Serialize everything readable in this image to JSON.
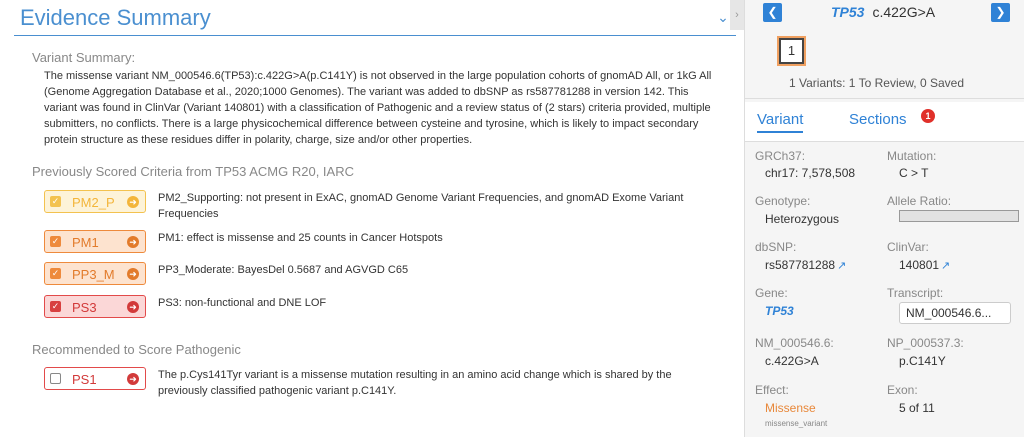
{
  "evidence": {
    "title": "Evidence Summary",
    "variant_summary_label": "Variant Summary:",
    "variant_summary_text": "The missense variant NM_000546.6(TP53):c.422G>A(p.C141Y) is not observed in the large population cohorts of gnomAD All, or 1kG All (Genome Aggregation Database et al., 2020;1000 Genomes). The variant was added to dbSNP as rs587781288 in version 142. This variant was found in ClinVar (Variant 140801) with a classification of Pathogenic and a review status of (2 stars) criteria provided, multiple submitters, no conflicts. There is a large physicochemical difference between cysteine and tyrosine, which is likely to impact secondary protein structure as these residues differ in polarity, charge, size and/or other properties.",
    "prev_scored_label": "Previously Scored Criteria from TP53 ACMG R20, IARC",
    "criteria": [
      {
        "label": "PM2_P",
        "description": "PM2_Supporting: not present in ExAC, gnomAD Genome Variant Frequencies, and gnomAD Exome Variant Frequencies",
        "color": "#f3c24f"
      },
      {
        "label": "PM1",
        "description": "PM1: effect is missense and 25 counts in Cancer Hotspots",
        "color": "#ee8a3c"
      },
      {
        "label": "PP3_M",
        "description": "PP3_Moderate: BayesDel 0.5687 and AGVGD C65",
        "color": "#ee8a3c"
      },
      {
        "label": "PS3",
        "description": "PS3: non-functional and DNE LOF",
        "color": "#e24a4a"
      }
    ],
    "recommended_label": "Recommended to Score Pathogenic",
    "recommended": [
      {
        "label": "PS1",
        "description": "The p.Cys141Tyr variant is a missense mutation resulting in an amino acid change which is shared by the previously classified pathogenic variant p.C141Y.",
        "color": "#e24a4a"
      }
    ]
  },
  "panel": {
    "gene": "TP53",
    "change": "c.422G>A",
    "variant_index": "1",
    "variant_count": "1 Variants: 1 To Review, 0 Saved",
    "tab_variant": "Variant",
    "tab_sections": "Sections",
    "sections_badge": "1",
    "fields": {
      "grch37_label": "GRCh37:",
      "grch37_value": "chr17: 7,578,508",
      "mutation_label": "Mutation:",
      "mutation_value": "C > T",
      "genotype_label": "Genotype:",
      "genotype_value": "Heterozygous",
      "allele_label": "Allele Ratio:",
      "dbsnp_label": "dbSNP:",
      "dbsnp_value": "rs587781288",
      "clinvar_label": "ClinVar:",
      "clinvar_value": "140801",
      "gene_label": "Gene:",
      "gene_value": "TP53",
      "transcript_label": "Transcript:",
      "transcript_value": "NM_000546.6...",
      "nm_label": "NM_000546.6:",
      "nm_value": "c.422G>A",
      "np_label": "NP_000537.3:",
      "np_value": "p.C141Y",
      "effect_label": "Effect:",
      "effect_value": "Missense",
      "effect_sub": "missense_variant",
      "exon_label": "Exon:",
      "exon_value": "5 of 11"
    }
  },
  "colors": {
    "accent": "#2f82d6",
    "badge": "#e0302a"
  }
}
